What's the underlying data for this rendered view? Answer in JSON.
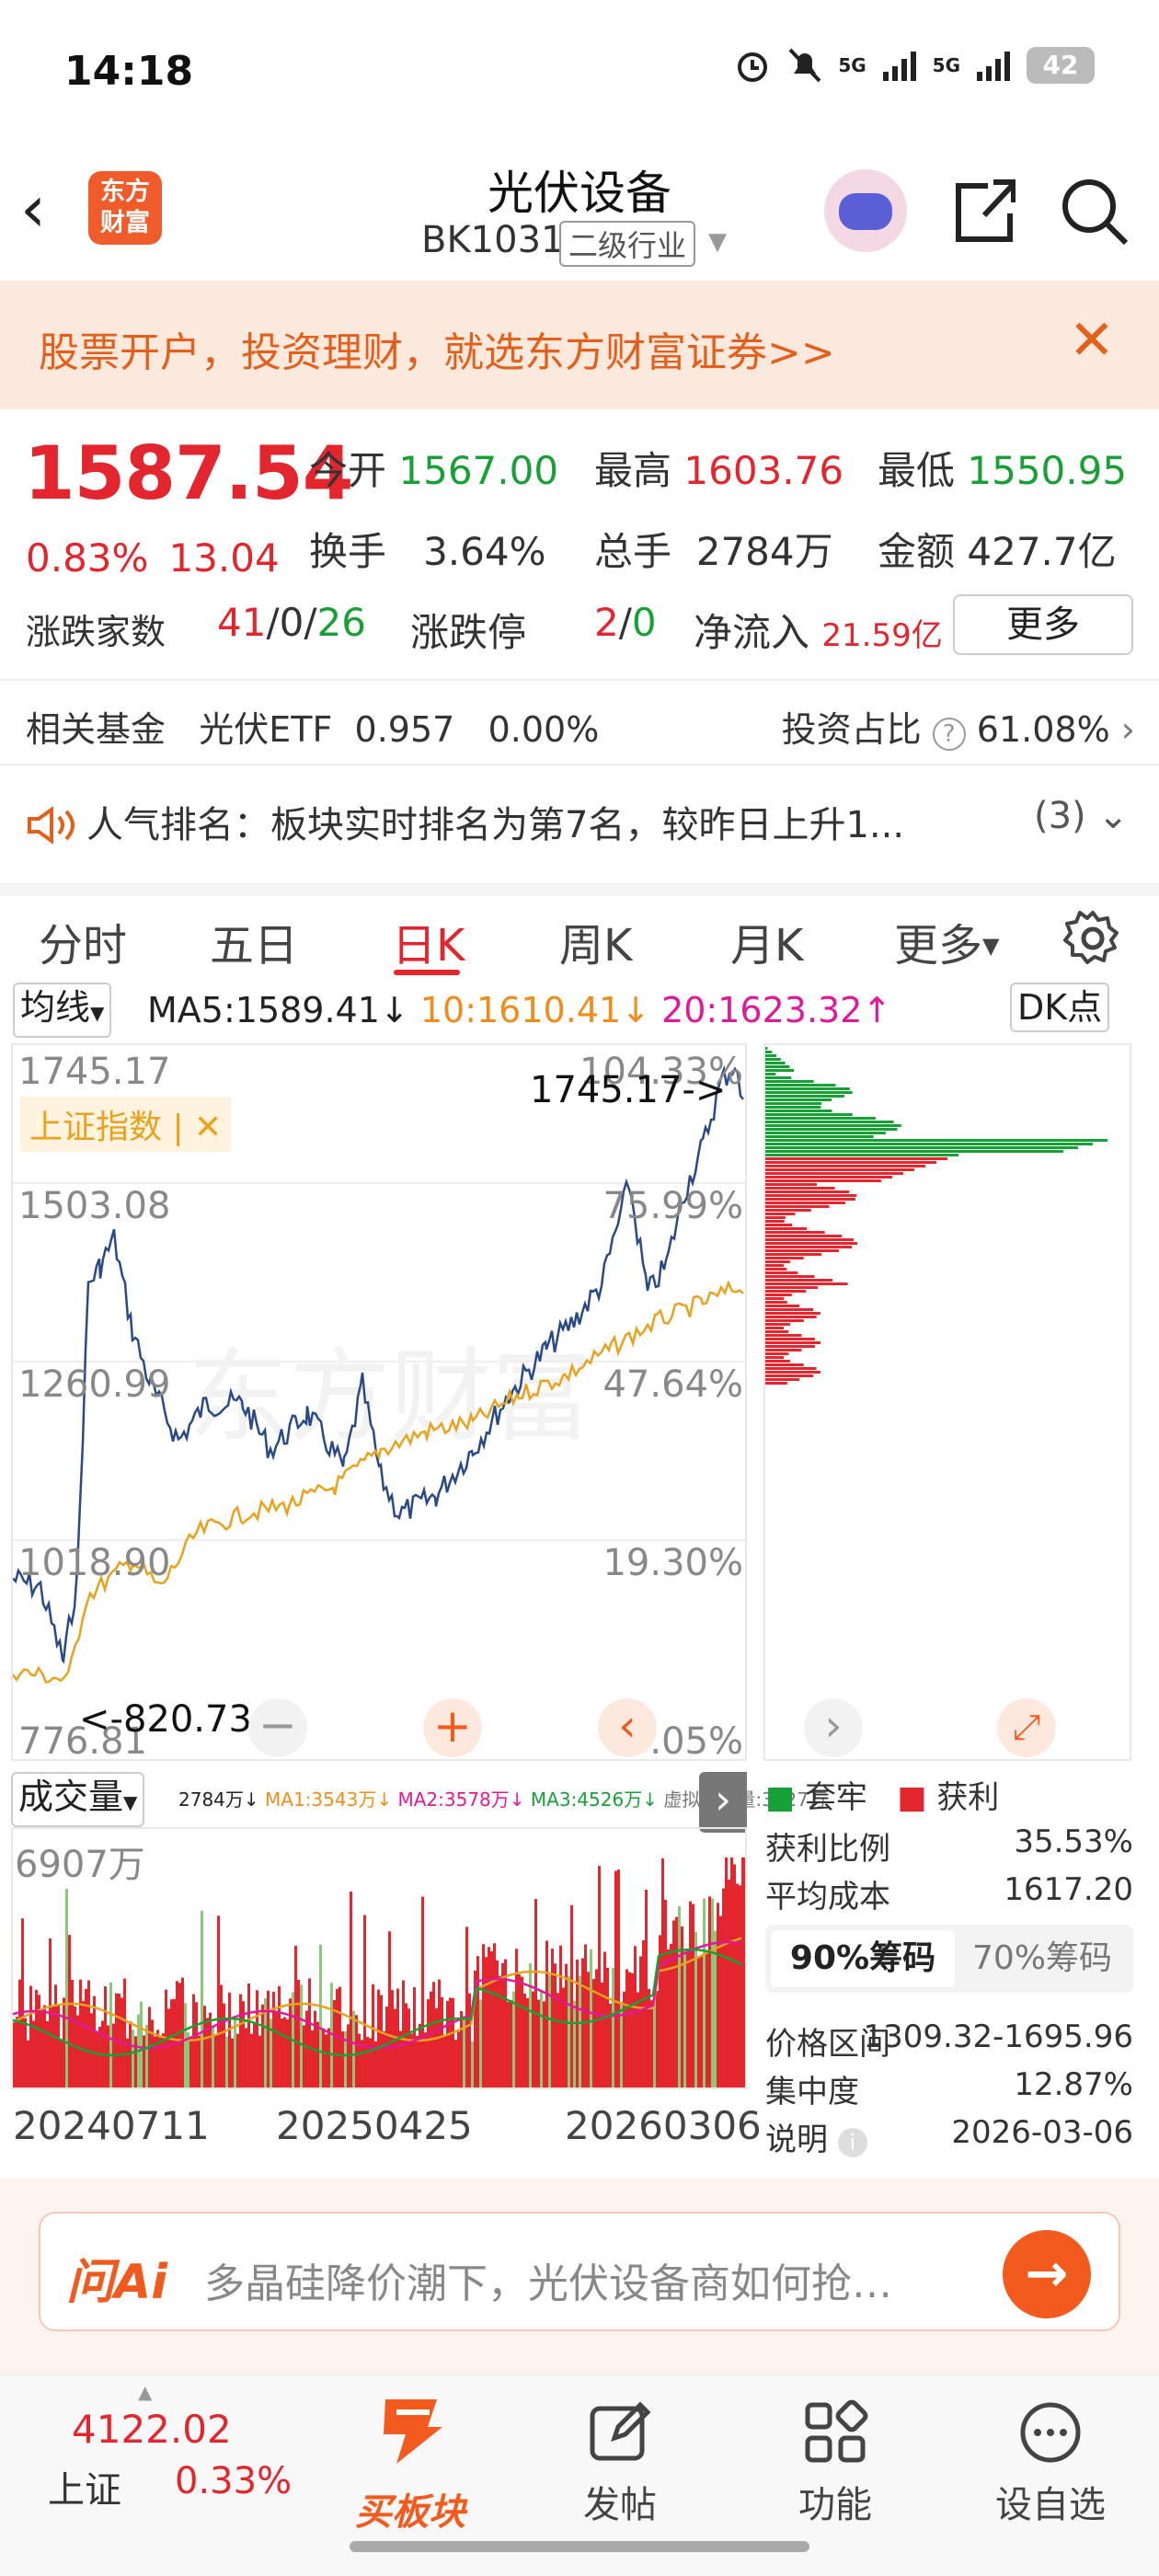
{
  "status": {
    "time": "14:18",
    "battery": "42",
    "net1": "5G",
    "net2": "5G"
  },
  "header": {
    "title": "光伏设备",
    "code": "BK1031",
    "tag": "二级行业",
    "logo": "东方\n财富"
  },
  "banner": {
    "text": "股票开户，投资理财，就选东方财富证券>>"
  },
  "quote": {
    "price": "1587.54",
    "pct": "0.83%",
    "change": "13.04",
    "open_label": "今开",
    "open": "1567.00",
    "high_label": "最高",
    "high": "1603.76",
    "low_label": "最低",
    "low": "1550.95",
    "turnover_label": "换手",
    "turnover": "3.64%",
    "vol_label": "总手",
    "vol": "2784万",
    "amount_label": "金额",
    "amount": "427.7亿",
    "breadth_label": "涨跌家数",
    "up": "41",
    "flat": "0",
    "down": "26",
    "limit_label": "涨跌停",
    "limit_up": "2",
    "limit_down": "0",
    "inflow_label": "净流入",
    "inflow": "21.59亿",
    "more": "更多"
  },
  "fund": {
    "label": "相关基金",
    "name": "光伏ETF",
    "value": "0.957",
    "pct": "0.00%",
    "ratio_label": "投资占比",
    "ratio": "61.08%"
  },
  "news": {
    "text": "人气排名：板块实时排名为第7名，较昨日上升1...",
    "count": "(3)"
  },
  "tabs": [
    "分时",
    "五日",
    "日K",
    "周K",
    "月K",
    "更多"
  ],
  "ma": {
    "dropdown": "均线",
    "ma5": "MA5:1589.41",
    "ma10": "10:1610.41",
    "ma20": "20:1623.32",
    "dk": "DK点"
  },
  "chart": {
    "y_labels": [
      "1745.17",
      "1503.08",
      "1260.99",
      "1018.90",
      "776.81"
    ],
    "pct_labels": [
      "104.33%",
      "75.99%",
      "47.64%",
      "19.30%",
      "-9.05%"
    ],
    "max_note": "1745.17->",
    "min_note": "<-820.73",
    "overlay": "上证指数 |",
    "watermark": "东方财富",
    "colors": {
      "index": "#2a4a86",
      "ref": "#e8a21e",
      "up": "#e3262d",
      "down": "#17a035"
    }
  },
  "vol": {
    "dropdown": "成交量",
    "v": "2784万",
    "ma1": "MA1:3543万",
    "ma2": "MA2:3578万",
    "ma3": "MA3:4526万",
    "virtual": "虚拟成交量:3227万",
    "max": "6907万",
    "dates": [
      "20240711",
      "20250425",
      "20260306"
    ]
  },
  "panel": {
    "legend_trap": "套牢",
    "legend_profit": "获利",
    "rows": [
      [
        "获利比例",
        "35.53%"
      ],
      [
        "平均成本",
        "1617.20"
      ]
    ],
    "tab90": "90%筹码",
    "tab70": "70%筹码",
    "rows2": [
      [
        "价格区间",
        "1309.32-1695.96"
      ],
      [
        "集中度",
        "12.87%"
      ],
      [
        "说明",
        "2026-03-06"
      ]
    ]
  },
  "ai": {
    "label": "问Ai",
    "placeholder": "多晶硅降价潮下，光伏设备商如何抢…"
  },
  "bottom": {
    "index_value": "4122.02",
    "index_name": "上证",
    "index_pct": "0.33%",
    "buy": "买板块",
    "post": "发帖",
    "func": "功能",
    "watch": "设自选"
  }
}
